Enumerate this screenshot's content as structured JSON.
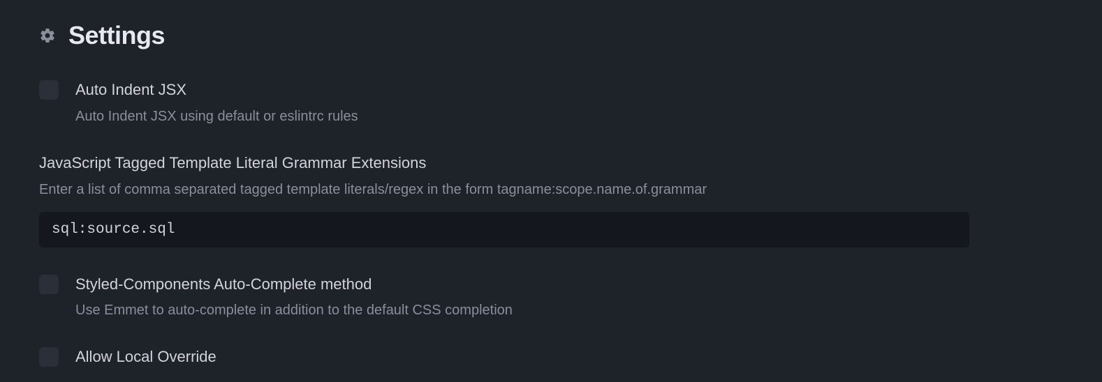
{
  "header": {
    "title": "Settings"
  },
  "settings": {
    "autoIndentJsx": {
      "label": "Auto Indent JSX",
      "description": "Auto Indent JSX using default or eslintrc rules"
    },
    "taggedTemplateGrammar": {
      "label": "JavaScript Tagged Template Literal Grammar Extensions",
      "description": "Enter a list of comma separated tagged template literals/regex in the form tagname:scope.name.of.grammar",
      "value": "sql:source.sql"
    },
    "styledComponentsAutocomplete": {
      "label": "Styled-Components Auto-Complete method",
      "description": "Use Emmet to auto-complete in addition to the default CSS completion"
    },
    "allowLocalOverride": {
      "label": "Allow Local Override"
    }
  }
}
